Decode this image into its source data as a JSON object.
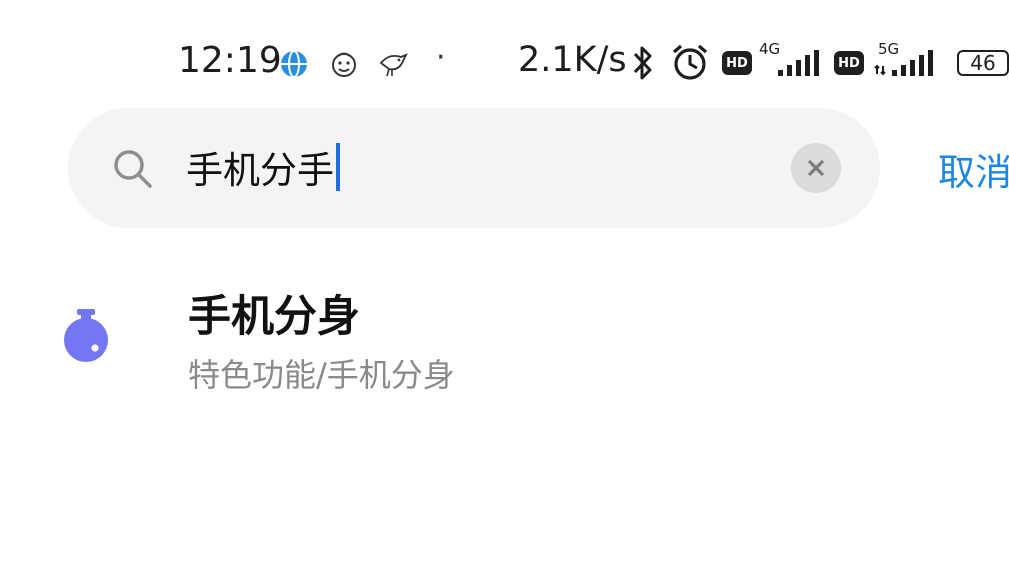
{
  "status_bar": {
    "time": "12:19",
    "notification_icons": [
      "globe-icon",
      "face-icon",
      "bird-icon"
    ],
    "more_dot": "·",
    "network_speed": "2.1K/s",
    "icons": [
      "bluetooth-icon",
      "alarm-icon"
    ],
    "sim1": {
      "hd": "HD",
      "network": "4G"
    },
    "sim2": {
      "hd": "HD",
      "network": "5G"
    },
    "battery": "46"
  },
  "search": {
    "query": "手机分手",
    "cancel_label": "取消",
    "colors": {
      "caret": "#1b6fe0",
      "cancel": "#1f86e6"
    }
  },
  "results": [
    {
      "title": "手机分身",
      "path": "特色功能/手机分身",
      "icon": "dual-apps-icon",
      "icon_color": "#7377f3"
    }
  ]
}
